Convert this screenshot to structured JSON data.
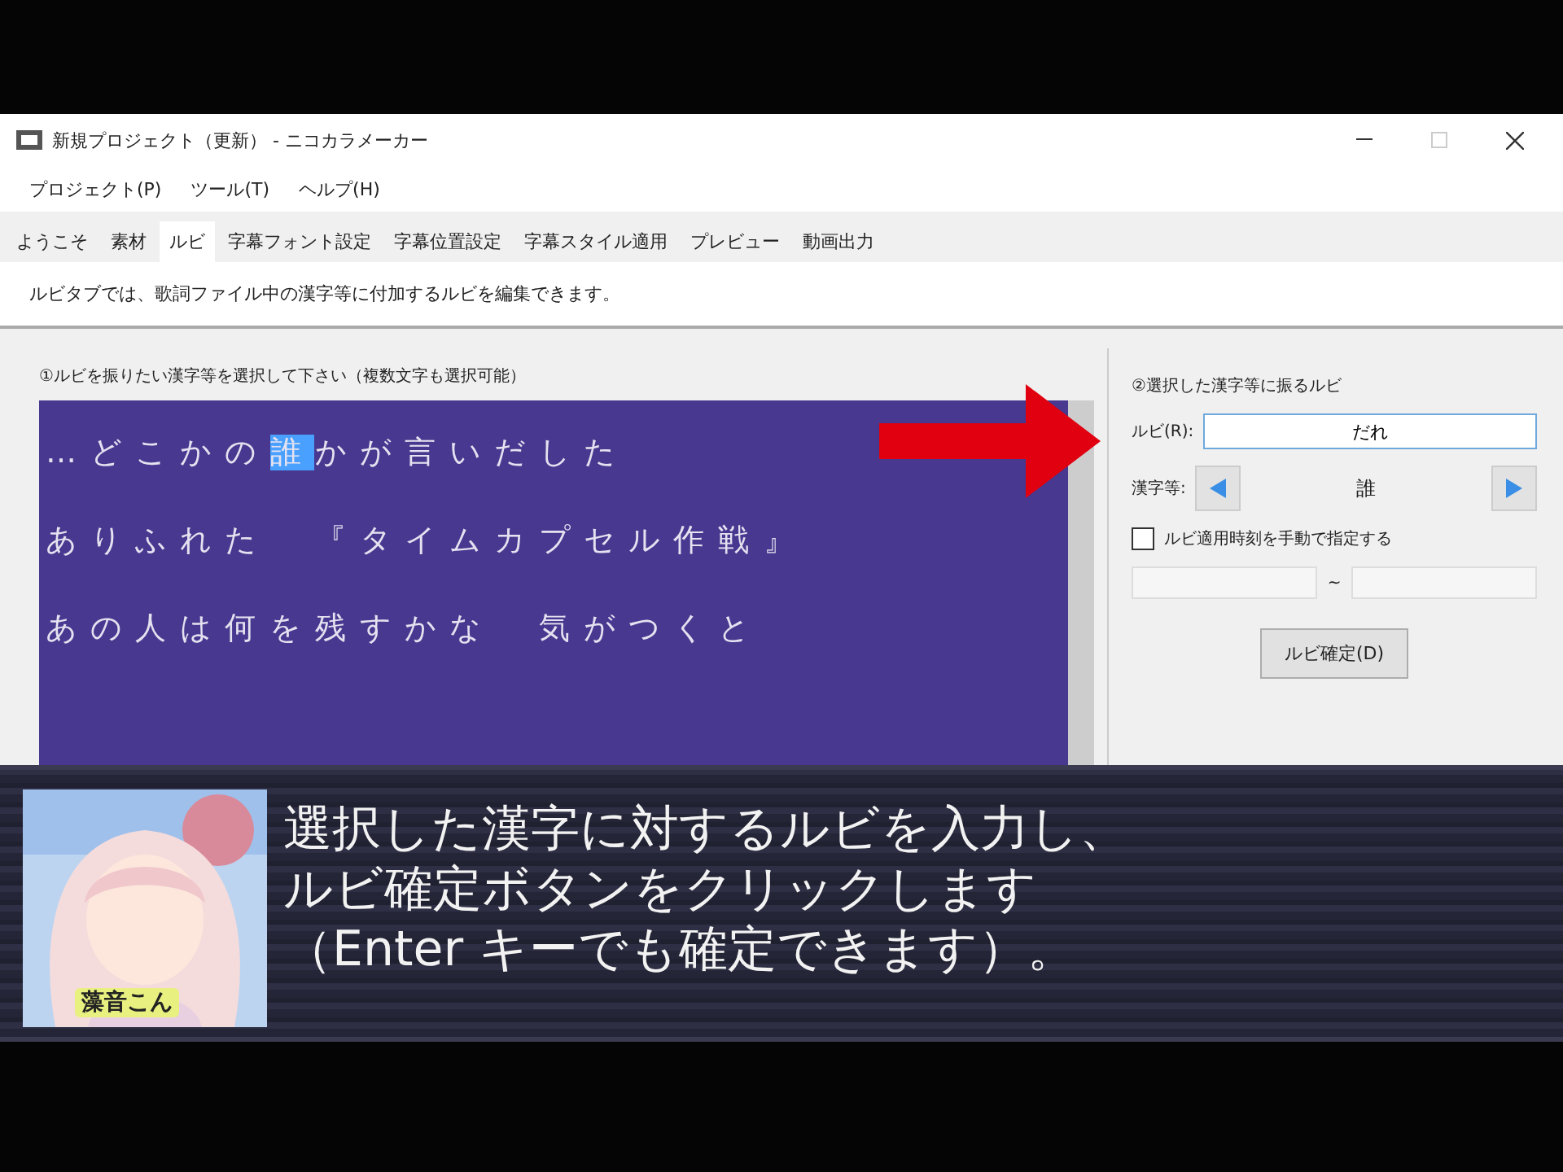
{
  "window": {
    "title": "新規プロジェクト（更新） - ニコカラメーカー"
  },
  "menu": [
    {
      "label": "プロジェクト(P)"
    },
    {
      "label": "ツール(T)"
    },
    {
      "label": "ヘルプ(H)"
    }
  ],
  "tabs": [
    {
      "label": "ようこそ",
      "selected": false
    },
    {
      "label": "素材",
      "selected": false
    },
    {
      "label": "ルビ",
      "selected": true
    },
    {
      "label": "字幕フォント設定",
      "selected": false
    },
    {
      "label": "字幕位置設定",
      "selected": false
    },
    {
      "label": "字幕スタイル適用",
      "selected": false
    },
    {
      "label": "プレビュー",
      "selected": false
    },
    {
      "label": "動画出力",
      "selected": false
    }
  ],
  "description": "ルビタブでは、歌詞ファイル中の漢字等に付加するルビを編集できます。",
  "lyrics_panel": {
    "label": "①ルビを振りたい漢字等を選択して下さい（複数文字も選択可能）",
    "lines": [
      [
        {
          "text": "…どこかの",
          "selected": false
        },
        {
          "text": "誰",
          "selected": true
        },
        {
          "text": "かが言いだした",
          "selected": false
        }
      ],
      [
        {
          "text": "ありふれた　『タイムカプセル作戦』",
          "selected": false
        }
      ],
      [
        {
          "text": "あの人は何を残すかな　気がつくと",
          "selected": false
        }
      ]
    ]
  },
  "ruby_panel": {
    "label": "②選択した漢字等に振るルビ",
    "ruby_label": "ルビ(R):",
    "ruby_value": "だれ",
    "kanji_label": "漢字等:",
    "kanji": "誰",
    "manual_time": {
      "label": "ルビ適用時刻を手動で指定する",
      "checked": false
    },
    "range_separator": "~",
    "confirm_button": "ルビ確定(D)"
  },
  "caption": {
    "speaker": "藻音こん",
    "lines": [
      "選択した漢字に対するルビを入力し、",
      "ルビ確定ボタンをクリックします",
      "（Enter キーでも確定できます）。"
    ]
  }
}
